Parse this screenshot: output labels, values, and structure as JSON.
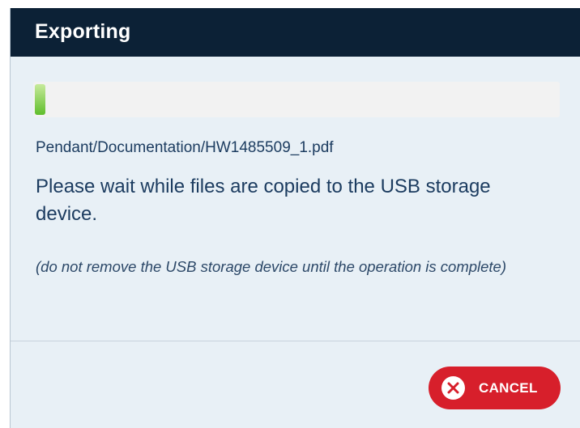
{
  "dialog": {
    "title": "Exporting",
    "progress": {
      "percent": 2,
      "fill_color": "#5fbe2c"
    },
    "file_path": "Pendant/Documentation/HW1485509_1.pdf",
    "message": "Please wait while files are copied to the USB storage device.",
    "note": "(do not remove the USB storage device until the operation is complete)",
    "cancel_button": {
      "label": "CANCEL",
      "icon": "close-circle-icon",
      "color": "#d71f2b"
    }
  },
  "colors": {
    "title_bar": "#0c2136",
    "dialog_background": "#e8f0f6",
    "text": "#1c3c60"
  }
}
